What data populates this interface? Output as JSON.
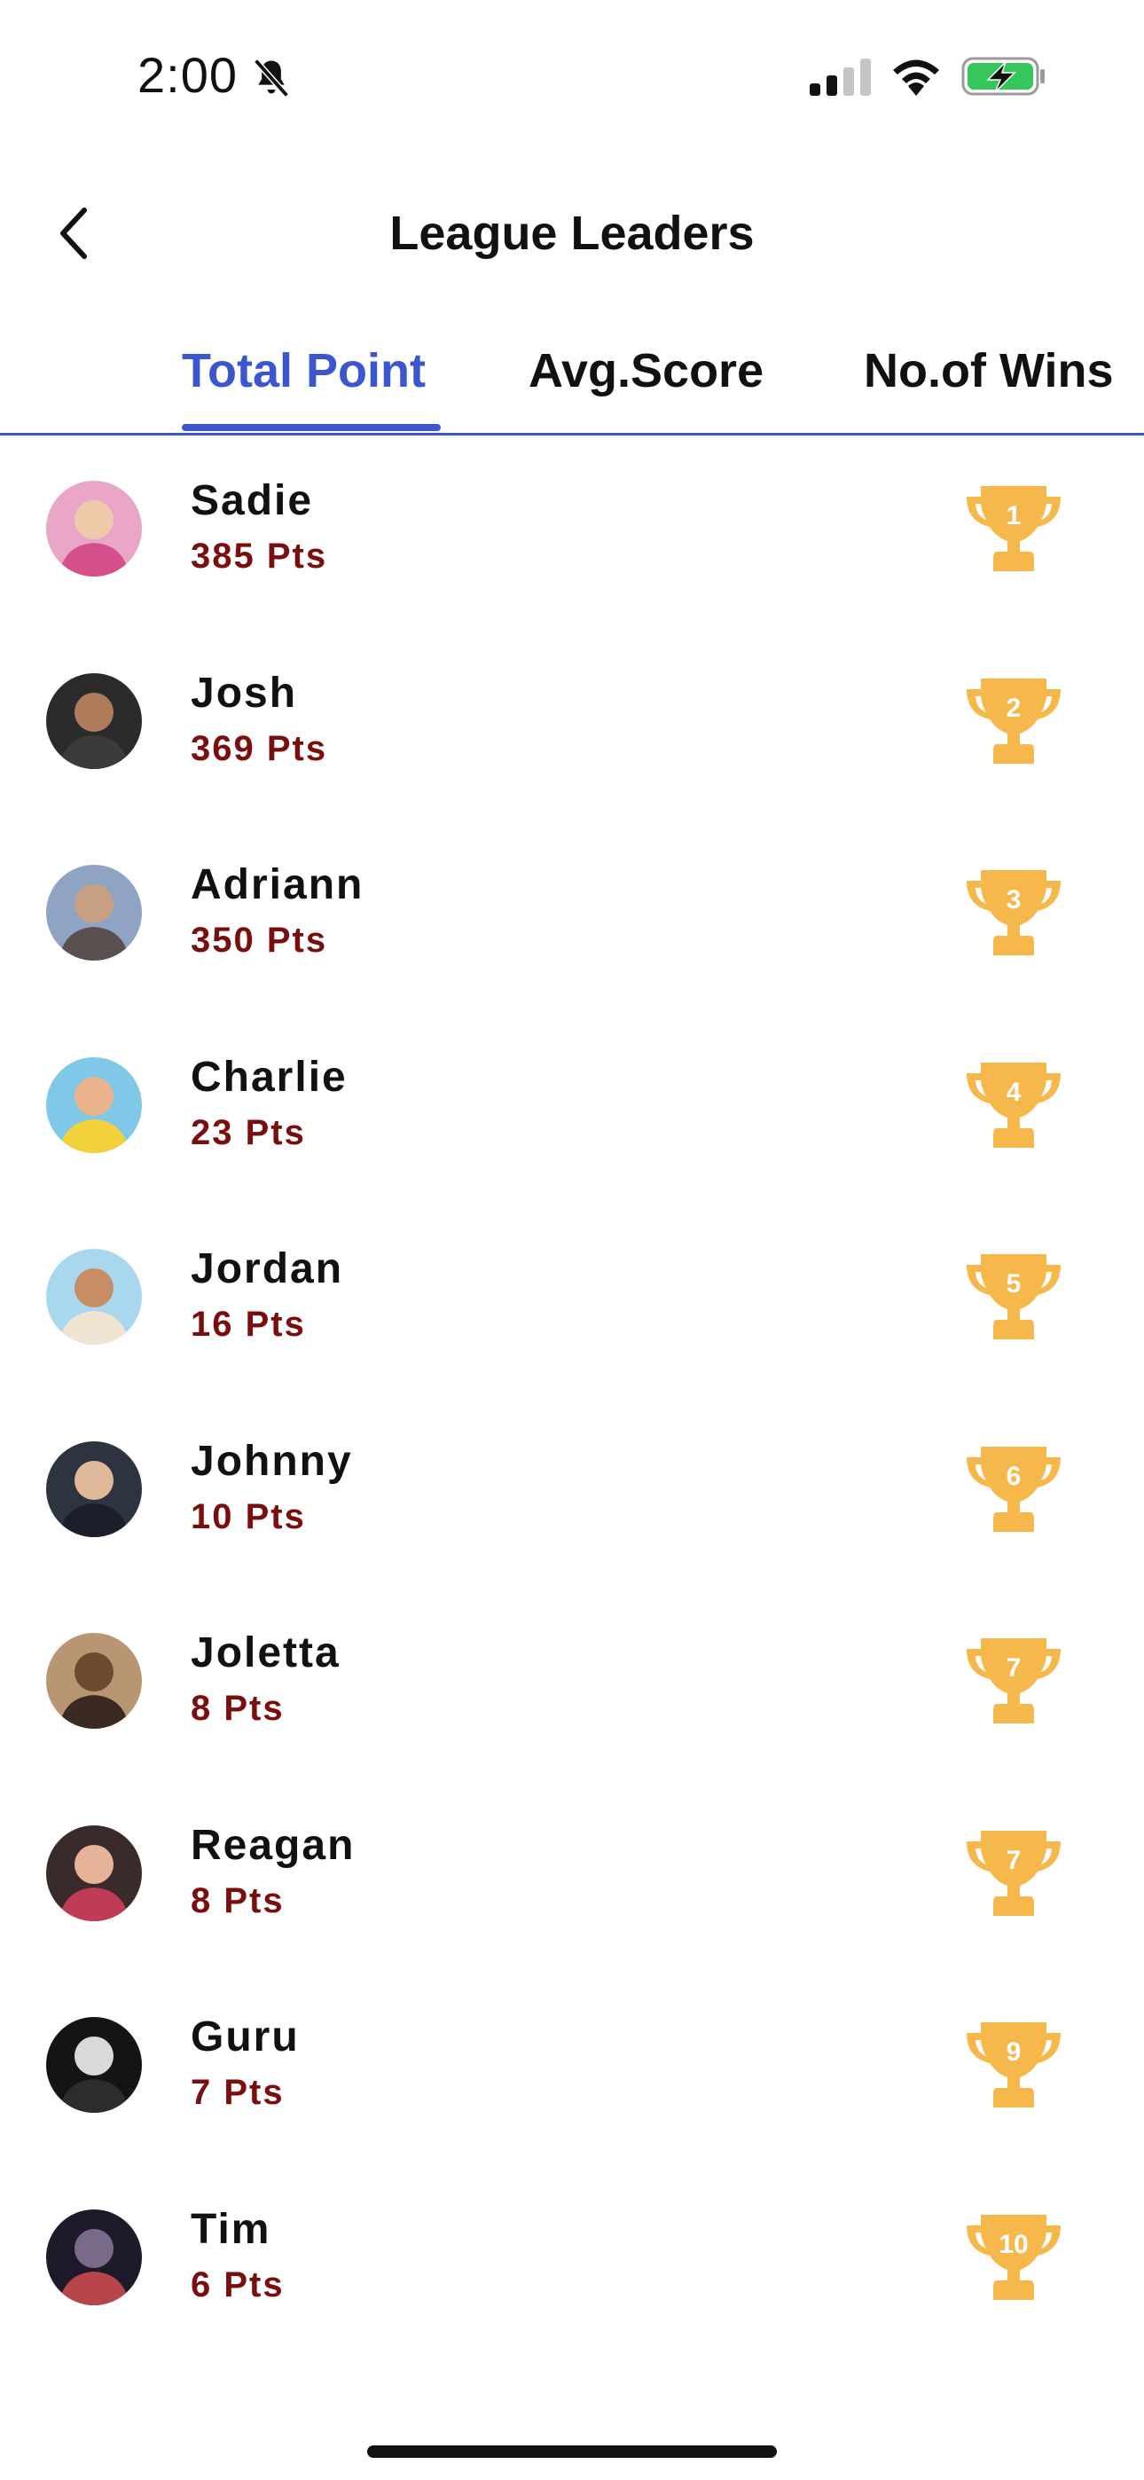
{
  "status_bar": {
    "time": "2:00",
    "icons": [
      "bell-slash-icon",
      "cellular-signal-icon",
      "wifi-icon",
      "battery-charging-icon"
    ]
  },
  "header": {
    "title": "League Leaders",
    "back_icon": "chevron-left-icon"
  },
  "tabs": [
    {
      "label": "Total Point",
      "active": true
    },
    {
      "label": "Avg.Score",
      "active": false
    },
    {
      "label": "No.of Wins",
      "active": false
    }
  ],
  "colors": {
    "accent": "#3c56cf",
    "points": "#7a0d0d",
    "trophy": "#f7b84b",
    "text": "#111111"
  },
  "leaders": [
    {
      "name": "Sadie",
      "points": "385 Pts",
      "rank": "1"
    },
    {
      "name": "Josh",
      "points": "369 Pts",
      "rank": "2"
    },
    {
      "name": "Adriann",
      "points": "350 Pts",
      "rank": "3"
    },
    {
      "name": "Charlie",
      "points": "23 Pts",
      "rank": "4"
    },
    {
      "name": "Jordan",
      "points": "16 Pts",
      "rank": "5"
    },
    {
      "name": "Johnny",
      "points": "10 Pts",
      "rank": "6"
    },
    {
      "name": "Joletta",
      "points": "8 Pts",
      "rank": "7"
    },
    {
      "name": "Reagan",
      "points": "8 Pts",
      "rank": "7"
    },
    {
      "name": "Guru",
      "points": "7 Pts",
      "rank": "9"
    },
    {
      "name": "Tim",
      "points": "6 Pts",
      "rank": "10"
    }
  ]
}
